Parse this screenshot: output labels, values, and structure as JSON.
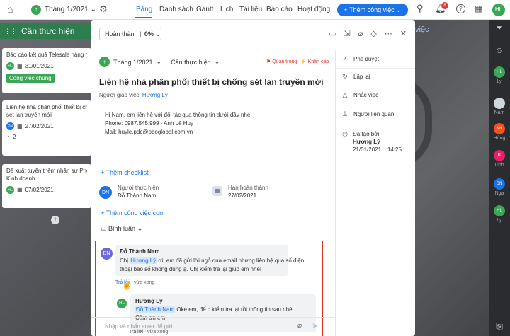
{
  "topbar": {
    "month": "Tháng 1/2021",
    "tabs": [
      "Bảng",
      "Danh sách",
      "Gantt",
      "Lịch",
      "Tài liệu",
      "Báo cáo",
      "Hoạt động"
    ],
    "add_button": "Thêm công việc",
    "notif_count": "8",
    "user": "HL"
  },
  "board": {
    "column_title": "Cần thực hiện",
    "column_title_2": "việc",
    "cards": [
      {
        "title": "Báo cáo kết quả Telesale hàng n",
        "avatar": "HL",
        "avatar_color": "#3aa757",
        "date": "31/01/2021",
        "tag": "Công việc chung"
      },
      {
        "title": "Liên hệ nhà phân phối thiết bị chống",
        "title2": "sét lan truyền mới",
        "avatar": "ĐN",
        "avatar_color": "#1a73e8",
        "date": "27/02/2021",
        "comments": "2"
      },
      {
        "title": "Đề xuất tuyển thêm nhân sự Pho",
        "title2": "Kinh doanh",
        "avatar": "HL",
        "avatar_color": "#3aa757",
        "date": "07/02/2021"
      }
    ]
  },
  "rightbar": {
    "members": [
      {
        "initials": "HL",
        "name": "Ly",
        "color": "#3aa757"
      },
      {
        "initials": "",
        "name": "Nam",
        "color": "#cfd8dc"
      },
      {
        "initials": "NH",
        "name": "Hùng",
        "color": "#f4511e"
      },
      {
        "initials": "TL",
        "name": "Linh",
        "color": "#e91e63"
      },
      {
        "initials": "ĐN",
        "name": "Nga",
        "color": "#1a73e8"
      },
      {
        "initials": "HL",
        "name": "Ly",
        "color": "#3aa757"
      }
    ]
  },
  "task": {
    "status": "Hoàn thành",
    "percent": "0%",
    "month": "Tháng 1/2021",
    "list": "Cần thực hiện",
    "flag_important": "Quan trọng",
    "flag_urgent": "Khẩn cấp",
    "title": "Liên hệ nhà phân phối thiết bị chống sét lan truyền mới",
    "assigner_label": "Người giao việc:",
    "assigner": "Hương Lý",
    "description": [
      "Hi Nam, em liên hệ với đối tác qua thông tin dưới đây nhé:",
      "Phone: 0987.545.999 - Anh Lê Huy",
      "Mail: huyle.pdc@oboglobal.com.vn"
    ],
    "add_checklist": "+ Thêm checklist",
    "assignee_label": "Người thực hiện",
    "assignee_initials": "ĐN",
    "assignee": "Đỗ Thành Nam",
    "due_label": "Hạn hoàn thành",
    "due": "27/02/2021",
    "add_subtask": "+ Thêm công việc con",
    "comments_label": "Bình luận",
    "comment1": {
      "initials": "ĐN",
      "author": "Đỗ Thành Nam",
      "pre": "Chị ",
      "mention": "Hương Lý",
      "text": " ơi, em đã gửi lời ngỏ qua email nhưng liên hệ qua số điện",
      "text2": "thoại báo số không đúng ạ. Chị kiểm tra lại giúp em nhé!",
      "reply": "Trả lời",
      "time": "· vừa xong"
    },
    "comment2": {
      "initials": "HL",
      "author": "Hương Lý",
      "mention": "Đỗ Thành Nam",
      "text": " Oke em, để c kiểm tra lại rồi thông tin sau nhé.",
      "text2": "Cảm ơn em",
      "reply": "Trả lời",
      "time": "· vừa xong"
    },
    "input_placeholder": "Nhập và nhấn enter để gửi",
    "side": {
      "approve": "Phê duyệt",
      "repeat": "Lặp lại",
      "remind": "Nhắc việc",
      "related": "Người liên quan",
      "created_label": "Đã tạo bởi",
      "created_by": "Hương Lý",
      "created_date": "21/01/2021",
      "created_time": "14:25"
    }
  }
}
